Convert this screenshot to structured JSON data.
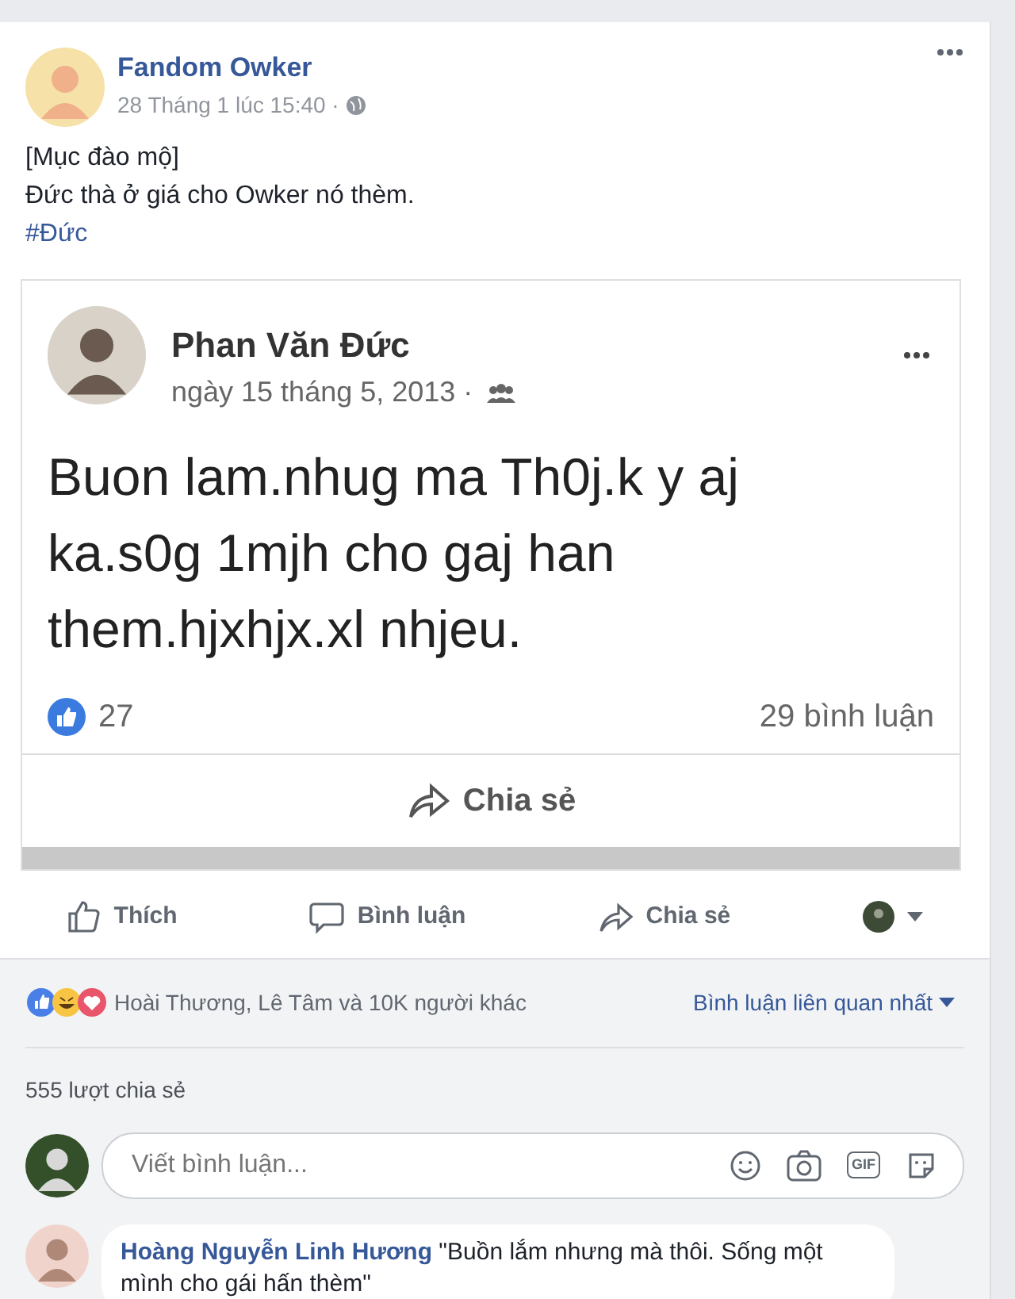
{
  "post": {
    "author": "Fandom Owker",
    "time": "28 Tháng 1 lúc 15:40 ·",
    "lines": [
      "[Mục đào mộ]",
      "Đức thà ở giá cho Owker nó thèm."
    ],
    "hashtag": "#Đức",
    "shared": {
      "author": "Phan Văn Đức",
      "date": "ngày 15 tháng 5, 2013 ·",
      "lines": [
        "Buon lam.nhug ma Th0j.k y aj",
        "ka.s0g 1mjh cho gaj han",
        "them.hjxhjx.xl nhjeu."
      ],
      "likes": "27",
      "comments": "29 bình luận",
      "share": "Chia sẻ"
    },
    "actions": [
      {
        "label": "Thích",
        "kind": "like"
      },
      {
        "label": "Bình luận",
        "kind": "comment"
      },
      {
        "label": "Chia sẻ",
        "kind": "share"
      }
    ],
    "reactions": "Hoài Thương, Lê Tâm và 10K người khác",
    "sort": "Bình luận liên quan nhất",
    "shares": "555 lượt chia sẻ",
    "comment_box": {
      "placeholder": "Viết bình luận...",
      "gif": "GIF"
    },
    "comments": [
      {
        "author": "Hoàng Nguyễn Linh Hương",
        "text": "\"Buồn lắm nhưng mà thôi. Sống một mình cho gái hấn thèm\""
      }
    ]
  }
}
